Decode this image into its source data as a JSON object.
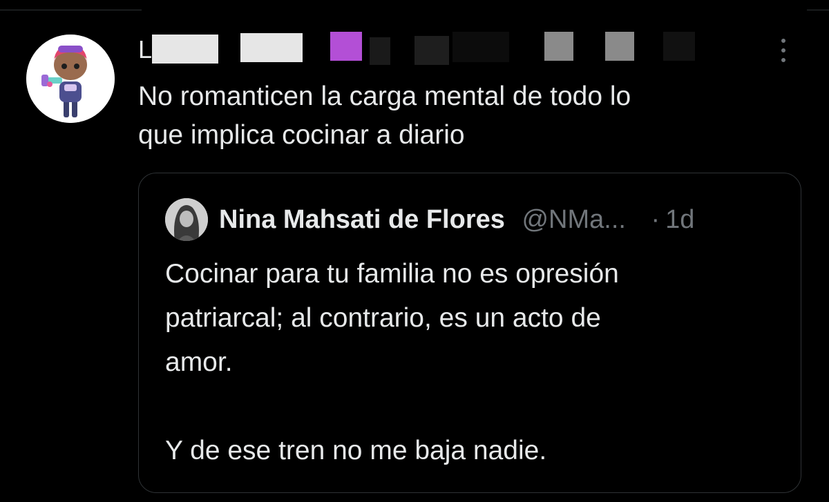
{
  "post": {
    "author_initial": "L",
    "text_line1": "No romanticen la carga mental de todo lo",
    "text_line2": "que implica cocinar a diario",
    "avatar_icon": "funko-character-avatar",
    "more_icon": "more-vertical-icon"
  },
  "quoted_post": {
    "name": "Nina Mahsati de Flores",
    "handle": "@NMa...",
    "separator": "·",
    "time": "1d",
    "text_line1": "Cocinar para tu familia no es opresión",
    "text_line2": "patriarcal; al contrario, es un acto de",
    "text_line3": "amor.",
    "text_line4": "Y de ese tren no me baja nadie."
  },
  "colors": {
    "background": "#000000",
    "text": "#e7e9ea",
    "secondary_text": "#71767b",
    "border": "#2f3336",
    "redaction_light": "#e6e6e6",
    "redaction_purple": "#b34fd6",
    "redaction_gray": "#8a8a8a"
  }
}
